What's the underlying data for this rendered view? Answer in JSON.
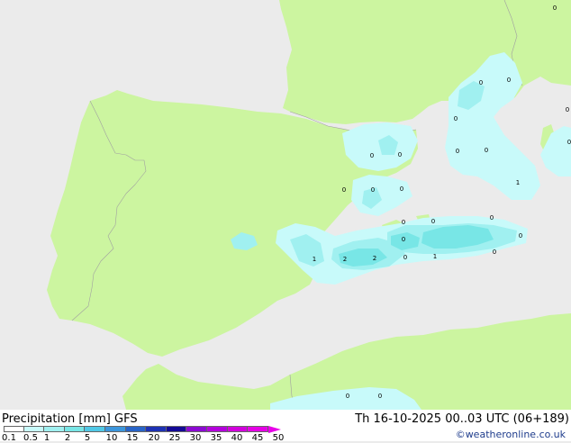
{
  "title": {
    "left": "Precipitation [mm]  GFS",
    "right": "Th 16-10-2025 00..03 UTC (06+189)",
    "credit": "©weatheronline.co.uk"
  },
  "legend": {
    "labels": [
      "0.1",
      "0.5",
      "1",
      "2",
      "5",
      "10",
      "15",
      "20",
      "25",
      "30",
      "35",
      "40",
      "45",
      "50"
    ],
    "colors": [
      "#ffffff",
      "#c8fafa",
      "#a0f0f0",
      "#78e6e6",
      "#50c8e6",
      "#3c96dc",
      "#2864c8",
      "#1e32b4",
      "#140a96",
      "#8c0ad2",
      "#b400dc",
      "#d200dc",
      "#e600e6",
      "#e800e8"
    ]
  },
  "map": {
    "colors": {
      "sea": "#ebebeb",
      "land": "#ccf5a0",
      "border": "#a0a0a0",
      "precip_light": "#c8fafa",
      "precip_mid": "#a0f0f0",
      "precip_high": "#78e6e6"
    },
    "labels": [
      "0",
      "0",
      "0",
      "0",
      "0",
      "0",
      "0",
      "0",
      "0",
      "0",
      "0",
      "0",
      "0",
      "0",
      "0",
      "0",
      "0",
      "0",
      "0",
      "1",
      "2",
      "2",
      "0",
      "1",
      "1",
      "0",
      "0"
    ]
  }
}
